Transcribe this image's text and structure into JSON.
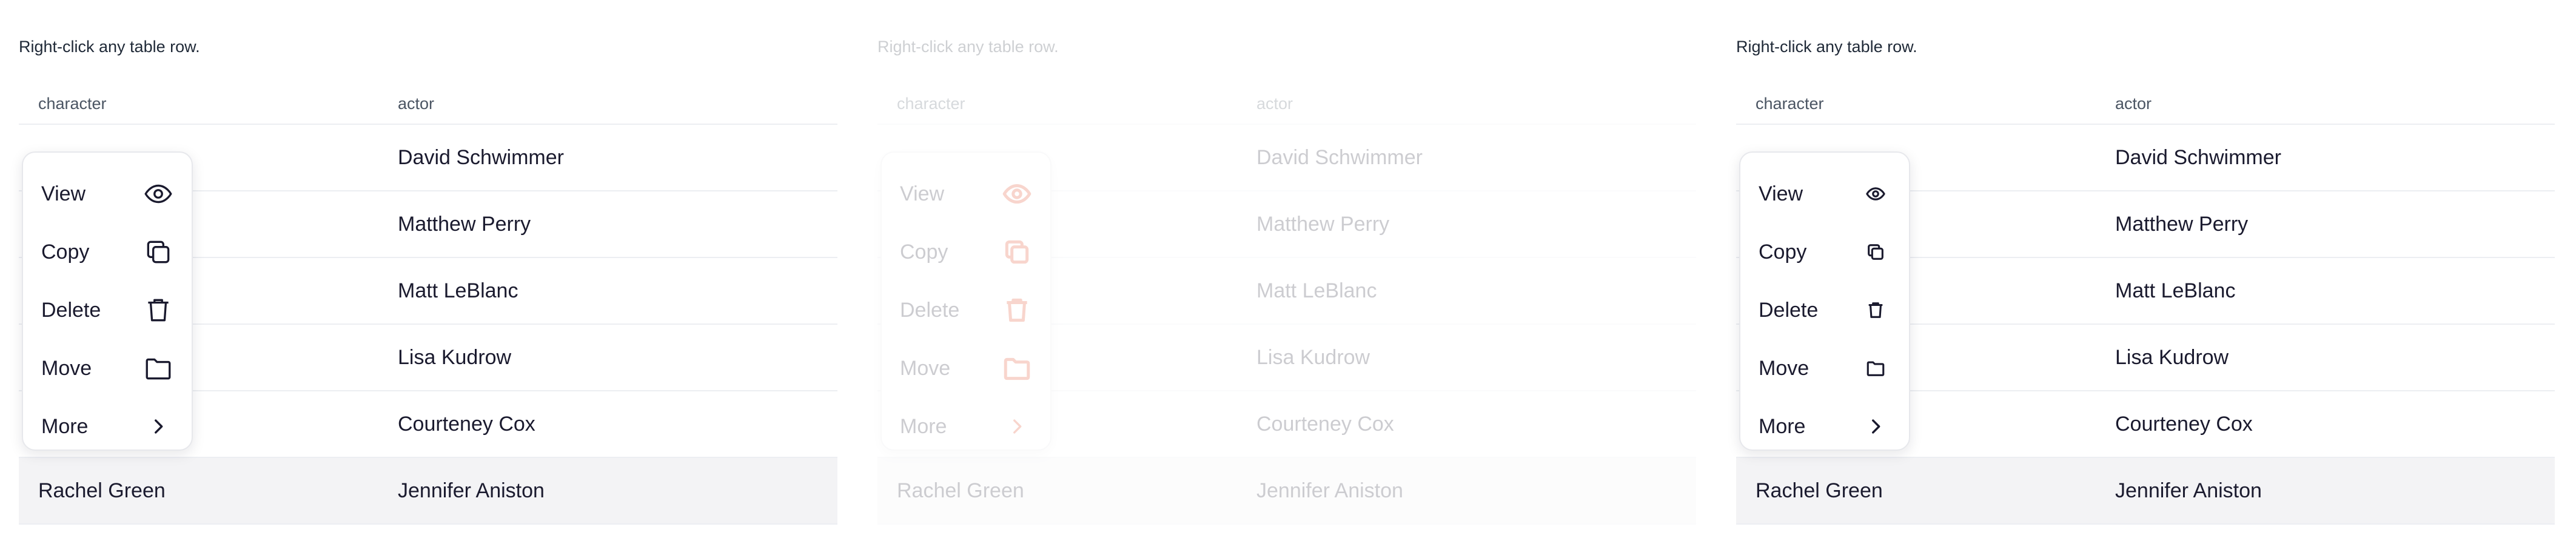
{
  "hint": "Right-click any table row.",
  "columns": {
    "character": "character",
    "actor": "actor"
  },
  "rows": [
    {
      "character": "",
      "actor": "David Schwimmer"
    },
    {
      "character": "",
      "actor": "Matthew Perry"
    },
    {
      "character": "",
      "actor": "Matt LeBlanc"
    },
    {
      "character": "",
      "actor": "Lisa Kudrow"
    },
    {
      "character": "",
      "actor": "Courteney Cox"
    },
    {
      "character": "Rachel Green",
      "actor": "Jennifer Aniston"
    }
  ],
  "menu": {
    "items": [
      {
        "label": "View",
        "icon": "eye-icon"
      },
      {
        "label": "Copy",
        "icon": "copy-icon"
      },
      {
        "label": "Delete",
        "icon": "trash-icon"
      },
      {
        "label": "Move",
        "icon": "folder-icon"
      },
      {
        "label": "More",
        "icon": "chevron-right-icon"
      }
    ]
  },
  "colors": {
    "icon_highlight": "#e0451f",
    "selected_row": "#f3f3f5"
  }
}
